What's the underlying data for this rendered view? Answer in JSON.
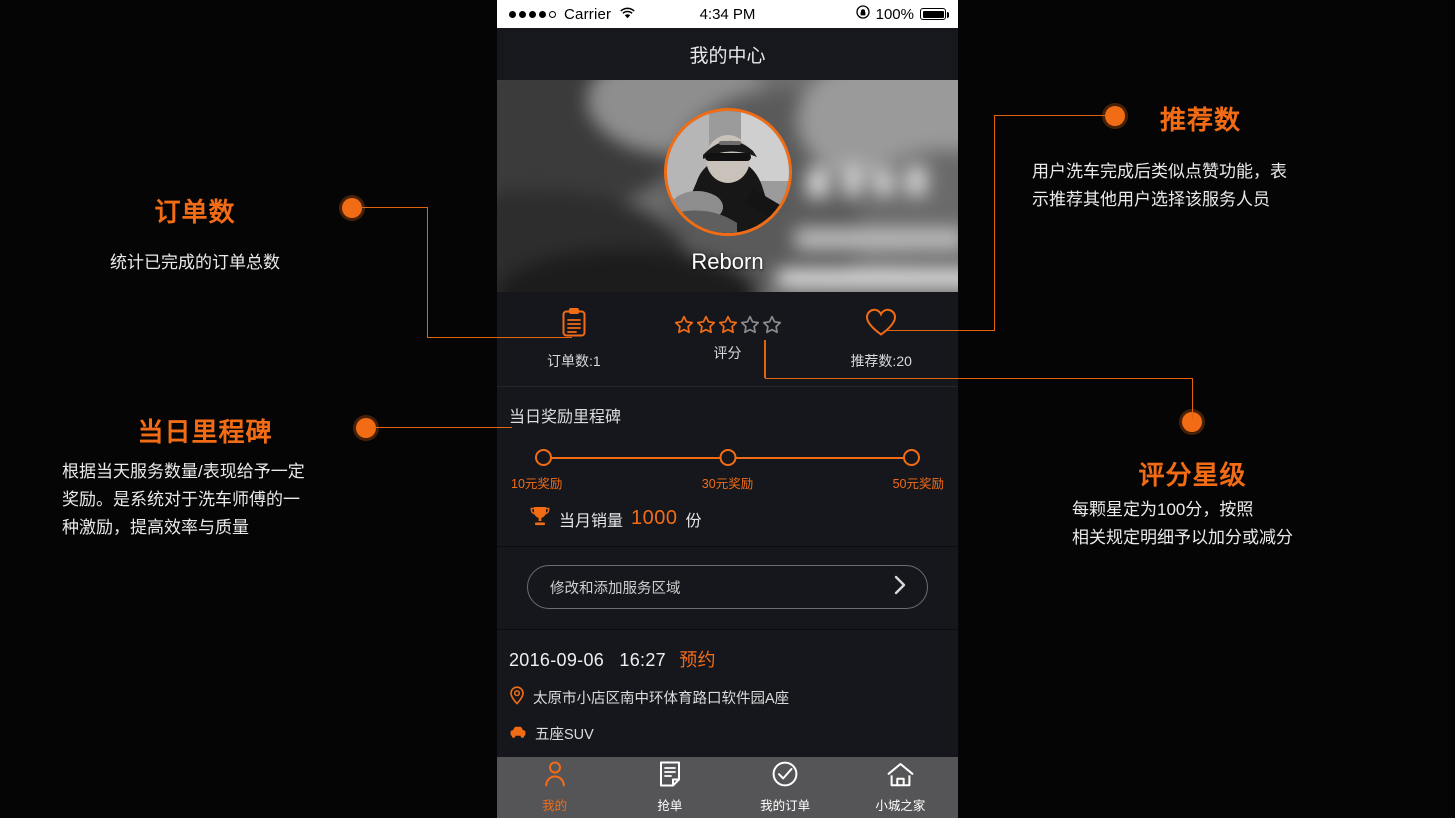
{
  "phone": {
    "status_bar": {
      "carrier": "Carrier",
      "time": "4:34 PM",
      "battery": "100%",
      "signal_dots_filled": 4,
      "signal_dots_total": 5,
      "wifi_icon": "wifi-icon",
      "lock_icon": "rotation-lock-icon"
    },
    "nav": {
      "title": "我的中心"
    },
    "hero": {
      "name": "Reborn",
      "avatar_icon": "avatar-photo"
    },
    "stats": [
      {
        "icon": "clipboard-icon",
        "label": "订单数:1"
      },
      {
        "icon": "stars-icon",
        "label": "评分",
        "stars_filled": 3,
        "stars_total": 5
      },
      {
        "icon": "heart-icon",
        "label": "推荐数:20"
      }
    ],
    "milestone": {
      "title": "当日奖励里程碑",
      "nodes": [
        "10元奖励",
        "30元奖励",
        "50元奖励"
      ],
      "sales_icon": "trophy-icon",
      "sales_prefix": "当月销量",
      "sales_value": "1000",
      "sales_suffix": "份"
    },
    "region_button": {
      "label": "修改和添加服务区域",
      "chevron": "chevron-right-icon"
    },
    "order": {
      "date": "2016-09-06",
      "time": "16:27",
      "tag": "预约",
      "location_icon": "map-pin-icon",
      "address": "太原市小店区南中环体育路口软件园A座",
      "car_icon": "car-icon",
      "car_type": "五座SUV"
    },
    "tabs": [
      {
        "label": "我的",
        "icon": "person-icon",
        "active": true
      },
      {
        "label": "抢单",
        "icon": "document-icon",
        "active": false
      },
      {
        "label": "我的订单",
        "icon": "check-circle-icon",
        "active": false
      },
      {
        "label": "小城之家",
        "icon": "home-icon",
        "active": false
      }
    ]
  },
  "annotations": {
    "orders": {
      "heading": "订单数",
      "desc": "统计已完成的订单总数"
    },
    "milestone": {
      "heading": "当日里程碑",
      "desc_line1": "根据当天服务数量/表现给予一定",
      "desc_line2": "奖励。是系统对于洗车师傅的一",
      "desc_line3": "种激励，提高效率与质量"
    },
    "recommend": {
      "heading": "推荐数",
      "desc_line1": "用户洗车完成后类似点赞功能，表",
      "desc_line2": "示推荐其他用户选择该服务人员"
    },
    "rating": {
      "heading": "评分星级",
      "desc_line1": "每颗星定为100分，按照",
      "desc_line2": "相关规定明细予以加分或减分"
    }
  },
  "colors": {
    "accent": "#f26c16",
    "background": "#050505",
    "panel": "#15171d",
    "tabbar": "#555557"
  }
}
